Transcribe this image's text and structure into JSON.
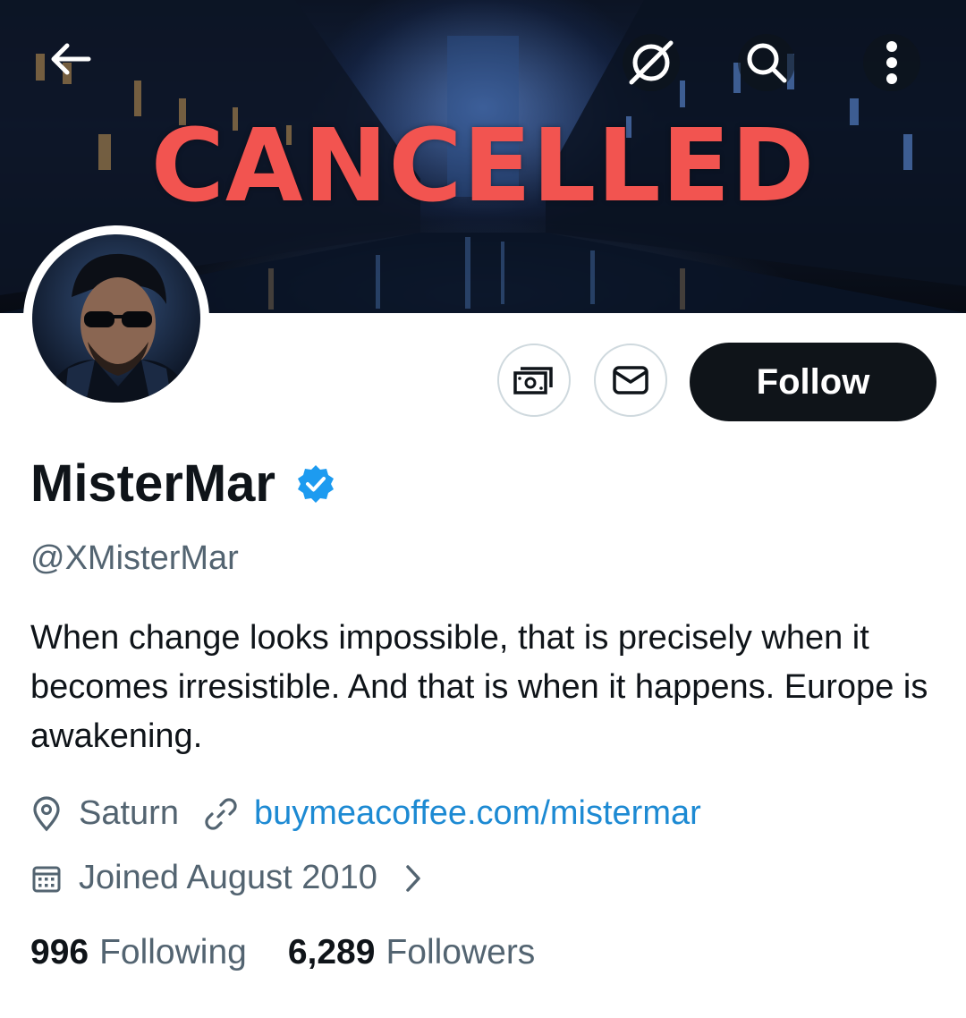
{
  "banner": {
    "overlay_text": "CANCELLED"
  },
  "header": {
    "back_icon": "arrow-left-icon",
    "grok_icon": "slashed-circle-icon",
    "search_icon": "search-icon",
    "more_icon": "vertical-dots-icon"
  },
  "actions": {
    "tip_icon": "money-icon",
    "message_icon": "envelope-icon",
    "follow_label": "Follow"
  },
  "profile": {
    "display_name": "MisterMar",
    "handle": "@XMisterMar",
    "bio": "When change looks impossible, that is precisely when it becomes irresistible. And that is when it happens. Europe is awakening.",
    "location": "Saturn",
    "website": "buymeacoffee.com/mistermar",
    "joined": "Joined August 2010"
  },
  "stats": {
    "following_count": "996",
    "following_label": "Following",
    "followers_count": "6,289",
    "followers_label": "Followers"
  },
  "colors": {
    "accent": "#1d9bf0",
    "link": "#1d8ad3",
    "overlay_red": "#f25450",
    "text": "#0f1419",
    "muted": "#536471"
  }
}
